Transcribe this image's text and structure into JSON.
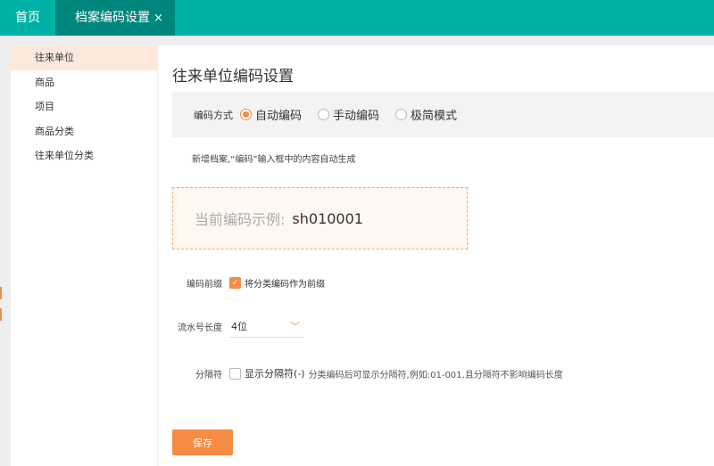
{
  "tabs": [
    {
      "label": "首页"
    },
    {
      "label": "档案编码设置",
      "close": "×"
    }
  ],
  "sidebar": {
    "items": [
      {
        "label": "往来单位"
      },
      {
        "label": "商品"
      },
      {
        "label": "项目"
      },
      {
        "label": "商品分类"
      },
      {
        "label": "往来单位分类"
      }
    ]
  },
  "main": {
    "title": "往来单位编码设置",
    "mode": {
      "label": "编码方式",
      "options": [
        "自动编码",
        "手动编码",
        "极简模式"
      ],
      "selected": "自动编码"
    },
    "hint": "新增档案,“编码”输入框中的内容自动生成",
    "example": {
      "label": "当前编码示例:",
      "value": "sh010001"
    },
    "prefix": {
      "label": "编码前缀",
      "checkbox": "将分类编码作为前缀",
      "checked": true
    },
    "serial": {
      "label": "流水号长度",
      "value": "4位"
    },
    "separator": {
      "label": "分隔符",
      "checkbox": "显示分隔符(-)",
      "checked": false,
      "desc": "分类编码后可显示分隔符,例如:01-001,且分隔符不影响编码长度"
    },
    "save": "保存"
  },
  "colors": {
    "teal": "#00b2a6",
    "accent": "#f58b45"
  }
}
